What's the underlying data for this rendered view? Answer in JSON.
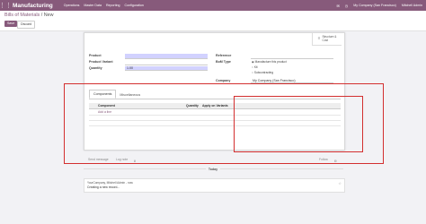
{
  "topbar": {
    "app_title": "Manufacturing",
    "menu": [
      "Operations",
      "Master Data",
      "Reporting",
      "Configuration"
    ],
    "company": "My Company (San Francisco)",
    "user": "Mitchell Admin",
    "apps_icon": "grid-icon",
    "bell_icon": "bell-icon",
    "chat_icon": "chat-icon",
    "accent": "#875a7b"
  },
  "breadcrumb": {
    "parent": "Bills of Materials",
    "separator": " / ",
    "current": "New"
  },
  "buttons": {
    "save": "Save",
    "discard": "Discard"
  },
  "stat_button": {
    "line1": "Structure &",
    "line2": "Cost",
    "icon": "list-icon"
  },
  "form": {
    "product_label": "Product",
    "product_variant_label": "Product Variant",
    "quantity_label": "Quantity",
    "quantity_value": "1.00",
    "reference_label": "Reference",
    "bom_type_label": "BoM Type",
    "bom_type_options": [
      "Manufacture this product",
      "Kit",
      "Subcontracting"
    ],
    "company_label": "Company",
    "company_value": "My Company (San Francisco)",
    "required_color": "#d2d2ff"
  },
  "notebook": {
    "tabs": [
      "Components",
      "Miscellaneous"
    ],
    "columns": [
      "Component",
      "Quantity",
      "Apply on Variants"
    ],
    "add_line": "Add a line"
  },
  "chatter": {
    "send_message": "Send message",
    "log_note": "Log note",
    "attachments_count": "0",
    "follow": "Follow",
    "followers_count": "0",
    "today": "Today",
    "message_author": "YourCompany, Mitchell Admin - now",
    "message_text": "Creating a new record..."
  },
  "highlight": {
    "color": "#d32f2f"
  }
}
